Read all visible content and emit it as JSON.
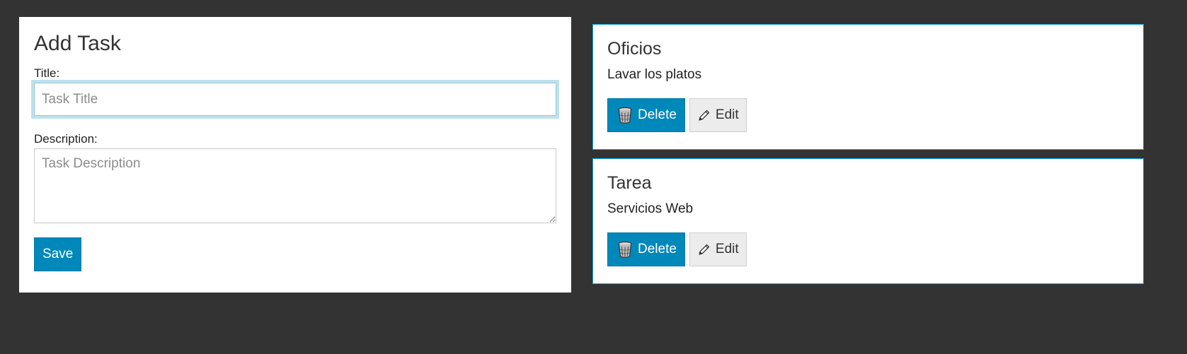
{
  "add_task": {
    "heading": "Add Task",
    "title_label": "Title:",
    "title_placeholder": "Task Title",
    "title_value": "",
    "description_label": "Description:",
    "description_placeholder": "Task Description",
    "description_value": "",
    "save_label": "Save"
  },
  "tasks": [
    {
      "title": "Oficios",
      "description": "Lavar los platos",
      "delete_label": "Delete",
      "edit_label": "Edit",
      "delete_icon": "trash-icon",
      "edit_icon": "pencil-icon"
    },
    {
      "title": "Tarea",
      "description": "Servicios Web",
      "delete_label": "Delete",
      "edit_label": "Edit",
      "delete_icon": "trash-icon",
      "edit_icon": "pencil-icon"
    }
  ],
  "colors": {
    "background": "#333333",
    "primary": "#0088bb",
    "card_border": "#0aa7e0",
    "focus_ring": "#bfe1ec"
  }
}
